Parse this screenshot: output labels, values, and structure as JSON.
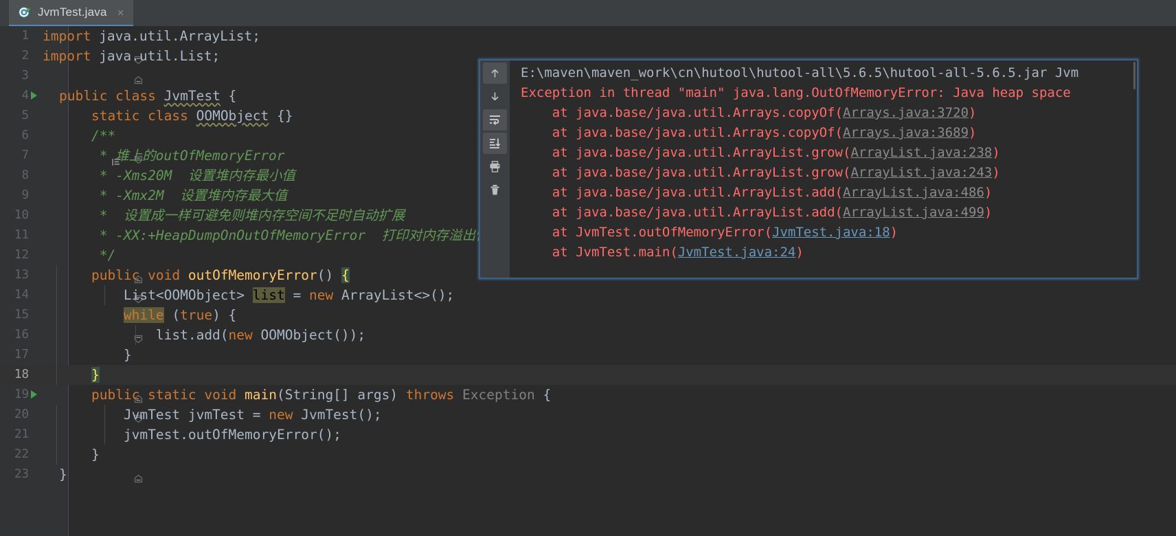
{
  "tab": {
    "label": "JvmTest.java",
    "close_label": "×",
    "icon": "java-class-runnable-icon",
    "active_underline_color": "#4a88c7"
  },
  "editor": {
    "theme": "darcula",
    "background": "#2b2b2b",
    "gutter_background": "#313335",
    "current_line": 18,
    "total_visible_lines": 23,
    "lines": [
      {
        "n": "1",
        "fold": "collapse-top",
        "run": false,
        "doc": false
      },
      {
        "n": "2",
        "fold": "collapse-bottom",
        "run": false,
        "doc": false
      },
      {
        "n": "3",
        "fold": "none",
        "run": false,
        "doc": false
      },
      {
        "n": "4",
        "fold": "none",
        "run": true,
        "doc": false
      },
      {
        "n": "5",
        "fold": "none",
        "run": false,
        "doc": false
      },
      {
        "n": "6",
        "fold": "collapse-top",
        "run": false,
        "doc": true
      },
      {
        "n": "7",
        "fold": "none",
        "run": false,
        "doc": false
      },
      {
        "n": "8",
        "fold": "none",
        "run": false,
        "doc": false
      },
      {
        "n": "9",
        "fold": "none",
        "run": false,
        "doc": false
      },
      {
        "n": "10",
        "fold": "none",
        "run": false,
        "doc": false
      },
      {
        "n": "11",
        "fold": "none",
        "run": false,
        "doc": false
      },
      {
        "n": "12",
        "fold": "collapse-bottom",
        "run": false,
        "doc": false
      },
      {
        "n": "13",
        "fold": "collapse-top",
        "run": false,
        "doc": false
      },
      {
        "n": "14",
        "fold": "none",
        "run": false,
        "doc": false
      },
      {
        "n": "15",
        "fold": "collapse-top",
        "run": false,
        "doc": false
      },
      {
        "n": "16",
        "fold": "none",
        "run": false,
        "doc": false
      },
      {
        "n": "17",
        "fold": "collapse-bottom",
        "run": false,
        "doc": false
      },
      {
        "n": "18",
        "fold": "collapse-bottom",
        "run": false,
        "doc": false
      },
      {
        "n": "19",
        "fold": "collapse-top",
        "run": true,
        "doc": false
      },
      {
        "n": "20",
        "fold": "none",
        "run": false,
        "doc": false
      },
      {
        "n": "21",
        "fold": "none",
        "run": false,
        "doc": false
      },
      {
        "n": "22",
        "fold": "collapse-bottom",
        "run": false,
        "doc": false
      },
      {
        "n": "23",
        "fold": "none",
        "run": false,
        "doc": false
      }
    ],
    "source_text": [
      "import java.util.ArrayList;",
      "import java.util.List;",
      "",
      "public class JvmTest {",
      "    static class OOMObject {}",
      "    /**",
      "     * 堆上的outOfMemoryError",
      "     * -Xms20M  设置堆内存最小值",
      "     * -Xmx2M  设置堆内存最大值",
      "     *  设置成一样可避免则堆内存空间不足时自动扩展",
      "     * -XX:+HeapDumpOnOutOfMemoryError  打印对内存溢出快照",
      "     */",
      "    public void outOfMemoryError() {",
      "        List<OOMObject> list = new ArrayList<>();",
      "        while (true) {",
      "            list.add(new OOMObject());",
      "        }",
      "    }",
      "    public static void main(String[] args) throws Exception {",
      "        JvmTest jvmTest = new JvmTest();",
      "        jvmTest.outOfMemoryError();",
      "    }",
      "}"
    ],
    "tokens": {
      "kw_import": "import",
      "pkg_arraylist": " java.util.ArrayList;",
      "pkg_list": " java.util.List;",
      "kw_public": "public",
      "kw_class": "class",
      "cls_jvmtest": "JvmTest",
      "kw_static": "static",
      "cls_oomobject": "OOMObject",
      "kw_void": "void",
      "mth_oome": "outOfMemoryError",
      "mth_main": "main",
      "kw_new": "new",
      "kw_while": "while",
      "kw_true": "true",
      "kw_throws": "throws",
      "cls_exception": "Exception",
      "ident_list": "list",
      "javadoc_open": "/**",
      "javadoc_close": "*/",
      "comment_line_7": "* 堆上的outOfMemoryError",
      "comment_line_8": "* -Xms20M  设置堆内存最小值",
      "comment_line_9": "* -Xmx2M  设置堆内存最大值",
      "comment_line_10": "*  设置成一样可避免则堆内存空间不足时自动扩展",
      "comment_line_11": "* -XX:+HeapDumpOnOutOfMemoryError  打印对内存溢出快照"
    }
  },
  "console": {
    "toolbar": [
      {
        "name": "scroll-up-icon",
        "tooltip": "Up",
        "active": true
      },
      {
        "name": "scroll-down-icon",
        "tooltip": "Down",
        "active": false
      },
      {
        "name": "soft-wrap-icon",
        "tooltip": "Soft-Wrap",
        "active": true
      },
      {
        "name": "scroll-to-end-icon",
        "tooltip": "Scroll to End",
        "active": true
      },
      {
        "name": "print-icon",
        "tooltip": "Print",
        "active": false
      },
      {
        "name": "trash-icon",
        "tooltip": "Clear All",
        "active": false
      }
    ],
    "lines": [
      {
        "segments": [
          {
            "text": "E:\\maven\\maven_work\\cn\\hutool\\hutool-all\\5.6.5\\hutool-all-5.6.5.jar Jvm",
            "style": "grey"
          }
        ]
      },
      {
        "segments": [
          {
            "text": "Exception in thread \"main\" java.lang.OutOfMemoryError: Java heap space",
            "style": "err"
          }
        ]
      },
      {
        "segments": [
          {
            "text": "    at java.base/java.util.Arrays.copyOf(",
            "style": "err"
          },
          {
            "text": "Arrays.java:3720",
            "style": "link-grey"
          },
          {
            "text": ")",
            "style": "err"
          }
        ]
      },
      {
        "segments": [
          {
            "text": "    at java.base/java.util.Arrays.copyOf(",
            "style": "err"
          },
          {
            "text": "Arrays.java:3689",
            "style": "link-grey"
          },
          {
            "text": ")",
            "style": "err"
          }
        ]
      },
      {
        "segments": [
          {
            "text": "    at java.base/java.util.ArrayList.grow(",
            "style": "err"
          },
          {
            "text": "ArrayList.java:238",
            "style": "link-grey"
          },
          {
            "text": ")",
            "style": "err"
          }
        ]
      },
      {
        "segments": [
          {
            "text": "    at java.base/java.util.ArrayList.grow(",
            "style": "err"
          },
          {
            "text": "ArrayList.java:243",
            "style": "link-grey"
          },
          {
            "text": ")",
            "style": "err"
          }
        ]
      },
      {
        "segments": [
          {
            "text": "    at java.base/java.util.ArrayList.add(",
            "style": "err"
          },
          {
            "text": "ArrayList.java:486",
            "style": "link-grey"
          },
          {
            "text": ")",
            "style": "err"
          }
        ]
      },
      {
        "segments": [
          {
            "text": "    at java.base/java.util.ArrayList.add(",
            "style": "err"
          },
          {
            "text": "ArrayList.java:499",
            "style": "link-grey"
          },
          {
            "text": ")",
            "style": "err"
          }
        ]
      },
      {
        "segments": [
          {
            "text": "    at JvmTest.outOfMemoryError(",
            "style": "err"
          },
          {
            "text": "JvmTest.java:18",
            "style": "link-blue"
          },
          {
            "text": ")",
            "style": "err"
          }
        ]
      },
      {
        "segments": [
          {
            "text": "    at JvmTest.main(",
            "style": "err"
          },
          {
            "text": "JvmTest.java:24",
            "style": "link-blue"
          },
          {
            "text": ")",
            "style": "err"
          }
        ]
      }
    ]
  },
  "colors": {
    "background": "#2b2b2b",
    "gutter": "#313335",
    "keyword": "#cc7832",
    "identifier": "#a9b7c6",
    "method": "#ffc66d",
    "comment": "#629755",
    "error": "#ff6b68",
    "link_blue": "#6897bb",
    "link_grey": "#8a8a8a",
    "selection_highlight": "#5c5c3d",
    "brace_match": "#3b514d",
    "run_marker": "#499c54",
    "console_border": "#3d6185"
  }
}
